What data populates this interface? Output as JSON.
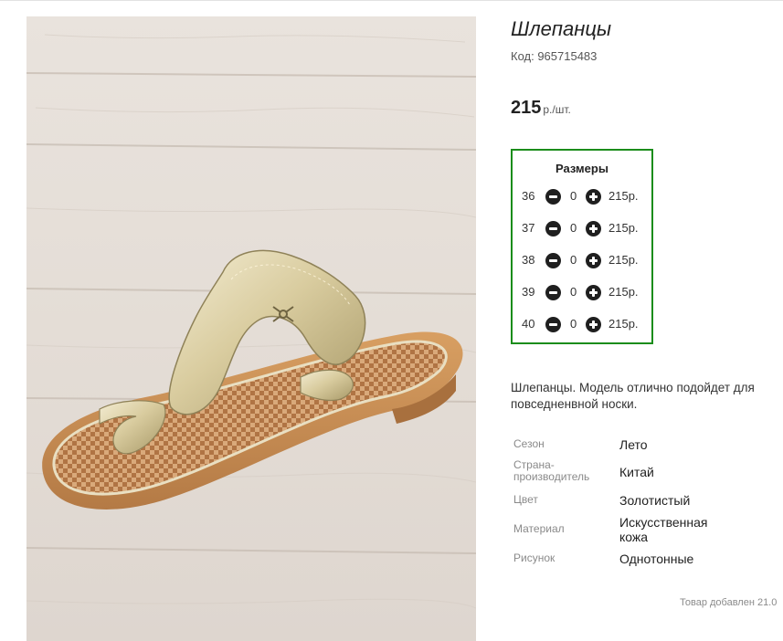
{
  "product": {
    "title": "Шлепанцы",
    "code": "Код: 965715483",
    "price_value": "215",
    "price_unit": "р./шт.",
    "photo_alt": "Шлепанцы"
  },
  "sizes": {
    "title": "Размеры",
    "rows": [
      {
        "size": "36",
        "qty": "0",
        "price": "215р."
      },
      {
        "size": "37",
        "qty": "0",
        "price": "215р."
      },
      {
        "size": "38",
        "qty": "0",
        "price": "215р."
      },
      {
        "size": "39",
        "qty": "0",
        "price": "215р."
      },
      {
        "size": "40",
        "qty": "0",
        "price": "215р."
      }
    ]
  },
  "description": "Шлепанцы. Модель отлично подойдет для повседненвной носки.",
  "attributes": [
    {
      "label": "Сезон",
      "value": "Лето"
    },
    {
      "label": "Страна-производитель",
      "value": "Китай"
    },
    {
      "label": "Цвет",
      "value": "Золотистый"
    },
    {
      "label": "Материал",
      "value": "Искусственная кожа"
    },
    {
      "label": "Рисунок",
      "value": "Однотонные"
    }
  ],
  "added_text": "Товар добавлен 21.0",
  "colors": {
    "sizes_border": "#1b8d1b",
    "button": "#1f1f1f",
    "label_gray": "#8a8a8a"
  },
  "icons": {
    "minus": "minus-circle-icon",
    "plus": "plus-circle-icon"
  }
}
